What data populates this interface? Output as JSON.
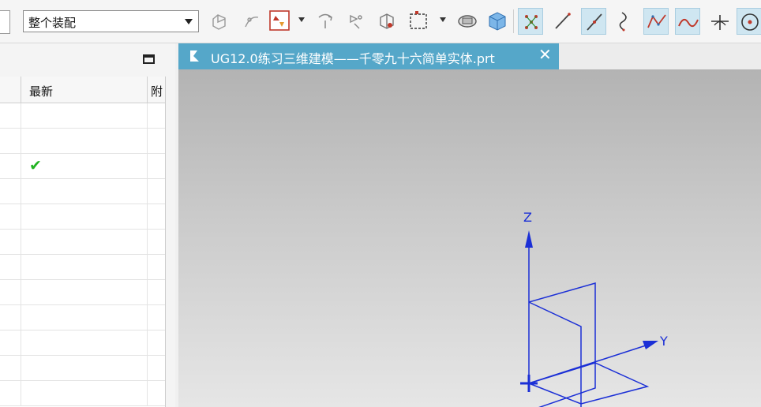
{
  "toolbar": {
    "assembly_select": {
      "value": "整个装配"
    },
    "tools": [
      {
        "icon": "snap-ghost-icon"
      },
      {
        "icon": "point-on-curve-icon"
      },
      {
        "icon": "selection-filter-icon"
      },
      {
        "icon": "rotate-view-icon"
      },
      {
        "icon": "move-component-icon"
      },
      {
        "icon": "view-orient-icon"
      },
      {
        "icon": "box-select-icon"
      },
      {
        "icon": "render-style-icon"
      },
      {
        "icon": "shaded-cube-icon"
      },
      {
        "icon": "snap-points-icon"
      },
      {
        "icon": "line-icon"
      },
      {
        "icon": "line-endpoints-icon"
      },
      {
        "icon": "curve-icon"
      },
      {
        "icon": "polyline-icon"
      },
      {
        "icon": "spline-icon"
      },
      {
        "icon": "intersection-icon"
      },
      {
        "icon": "point-icon"
      }
    ],
    "colors": {
      "active_bg": "#cfe6f1",
      "icon_red": "#c0392b",
      "icon_blue": "#2f6fb0"
    }
  },
  "navigator": {
    "columns": [
      {
        "label": ""
      },
      {
        "label": "最新"
      },
      {
        "label": "附"
      }
    ],
    "rows": [
      {
        "latest": ""
      },
      {
        "latest": ""
      },
      {
        "latest": "✔"
      },
      {
        "latest": ""
      },
      {
        "latest": ""
      },
      {
        "latest": ""
      },
      {
        "latest": ""
      },
      {
        "latest": ""
      },
      {
        "latest": ""
      },
      {
        "latest": ""
      },
      {
        "latest": ""
      },
      {
        "latest": ""
      }
    ],
    "check_color": "#22b322"
  },
  "graphics": {
    "tab": {
      "title": "UG12.0练习三维建模——千零九十六简单实体.prt",
      "close": "✕",
      "color": "#55a7c9"
    },
    "axes": {
      "z_label": "Z",
      "y_label": "Y",
      "color": "#1b2fd6"
    }
  }
}
